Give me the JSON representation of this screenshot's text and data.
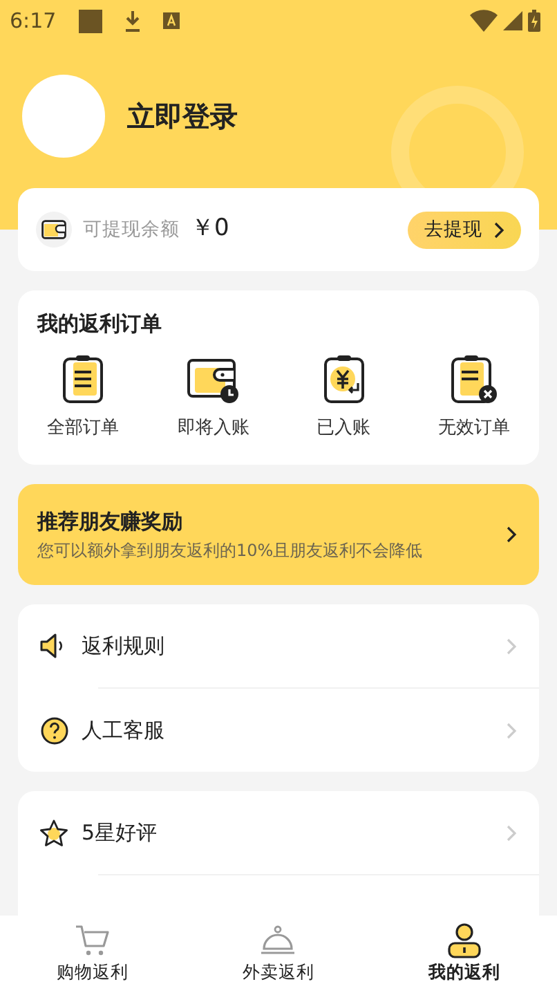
{
  "status_bar": {
    "time": "6:17"
  },
  "profile": {
    "login_label": "立即登录"
  },
  "balance": {
    "label": "可提现余额",
    "amount": "￥0",
    "button": "去提现"
  },
  "orders": {
    "title": "我的返利订单",
    "items": [
      {
        "kind": "all",
        "label": "全部订单"
      },
      {
        "kind": "pending",
        "label": "即将入账"
      },
      {
        "kind": "credited",
        "label": "已入账"
      },
      {
        "kind": "invalid",
        "label": "无效订单"
      }
    ]
  },
  "promo": {
    "title": "推荐朋友赚奖励",
    "subtitle": "您可以额外拿到朋友返利的10%且朋友返利不会降低"
  },
  "menu_groups": [
    [
      {
        "kind": "speaker",
        "label": "返利规则"
      },
      {
        "kind": "help",
        "label": "人工客服"
      }
    ],
    [
      {
        "kind": "star",
        "label": "5星好评"
      }
    ]
  ],
  "tabs": [
    {
      "kind": "cart",
      "label": "购物返利",
      "selected": false
    },
    {
      "kind": "bell",
      "label": "外卖返利",
      "selected": false
    },
    {
      "kind": "user",
      "label": "我的返利",
      "selected": true
    }
  ]
}
